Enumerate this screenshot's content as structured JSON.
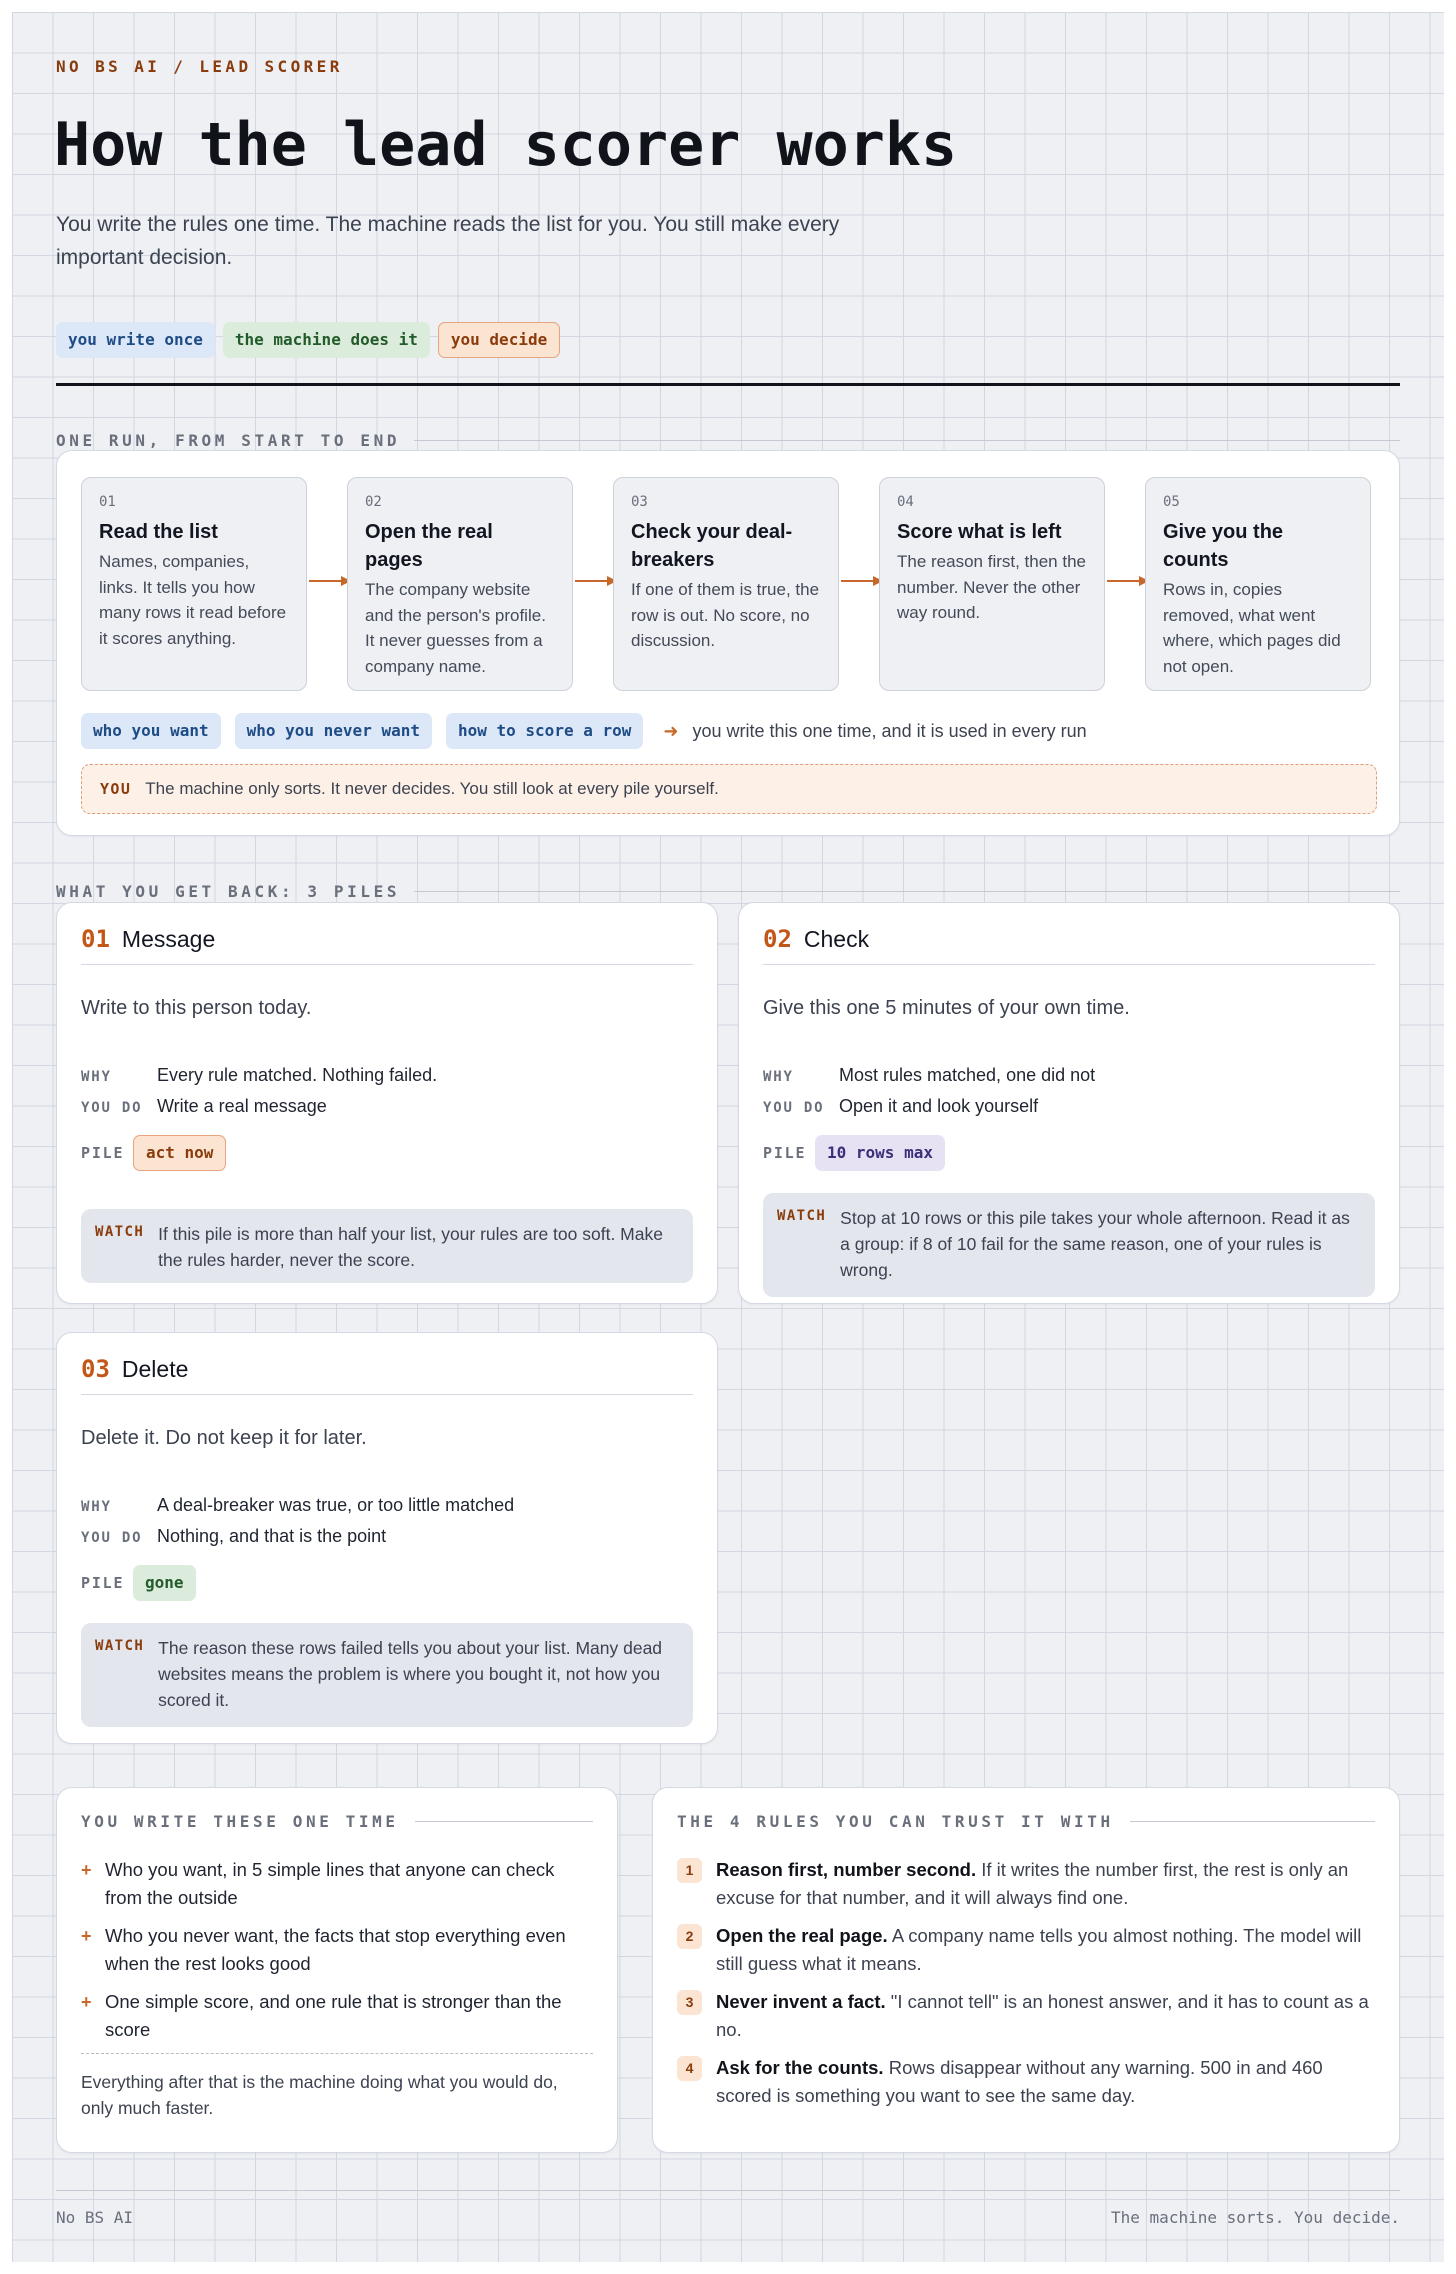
{
  "header": {
    "eyebrow": "NO BS AI / LEAD SCORER",
    "title": "How the lead scorer works",
    "lead": "You write the rules one time. The machine reads the list for you. You still make every important decision."
  },
  "legend": {
    "write_once": "you write once",
    "machine": "the machine does it",
    "decide": "you decide"
  },
  "run": {
    "label": "ONE RUN, FROM START TO END",
    "steps": [
      {
        "num": "01",
        "title": "Read the list",
        "desc": "Names, companies, links. It tells you how many rows it read before it scores anything."
      },
      {
        "num": "02",
        "title": "Open the real pages",
        "desc": "The company website and the person's profile. It never guesses from a company name."
      },
      {
        "num": "03",
        "title": "Check your deal-breakers",
        "desc": "If one of them is true, the row is out. No score, no discussion."
      },
      {
        "num": "04",
        "title": "Score what is left",
        "desc": "The reason first, then the number. Never the other way round."
      },
      {
        "num": "05",
        "title": "Give you the counts",
        "desc": "Rows in, copies removed, what went where, which pages did not open."
      }
    ],
    "inputs": [
      "who you want",
      "who you never want",
      "how to score a row"
    ],
    "inputs_note": "you write this one time, and it is used in every run",
    "you_key": "YOU",
    "you_text": "The machine only sorts. It never decides. You still look at every pile yourself."
  },
  "piles": {
    "label": "WHAT YOU GET BACK: 3 PILES",
    "why_key": "WHY",
    "do_key": "YOU DO",
    "pile_key": "PILE",
    "watch_key": "WATCH",
    "items": [
      {
        "num": "01",
        "title": "Message",
        "intro": "Write to this person today.",
        "why": "Every rule matched. Nothing failed.",
        "do": "Write a real message",
        "pile": "act now",
        "watch": "If this pile is more than half your list, your rules are too soft. Make the rules harder, never the score."
      },
      {
        "num": "02",
        "title": "Check",
        "intro": "Give this one 5 minutes of your own time.",
        "why": "Most rules matched, one did not",
        "do": "Open it and look yourself",
        "pile": "10 rows max",
        "watch": "Stop at 10 rows or this pile takes your whole afternoon. Read it as a group: if 8 of 10 fail for the same reason, one of your rules is wrong."
      },
      {
        "num": "03",
        "title": "Delete",
        "intro": "Delete it. Do not keep it for later.",
        "why": "A deal-breaker was true, or too little matched",
        "do": "Nothing, and that is the point",
        "pile": "gone",
        "watch": "The reason these rows failed tells you about your list. Many dead websites means the problem is where you bought it, not how you scored it."
      }
    ]
  },
  "write_once": {
    "label": "YOU WRITE THESE ONE TIME",
    "marker": "+",
    "items": [
      "Who you want, in 5 simple lines that anyone can check from the outside",
      "Who you never want, the facts that stop everything even when the rest looks good",
      "One simple score, and one rule that is stronger than the score"
    ],
    "note": "Everything after that is the machine doing what you would do, only much faster."
  },
  "trust_rules": {
    "label": "THE 4 RULES YOU CAN TRUST IT WITH",
    "items": [
      {
        "n": "1",
        "bold": "Reason first, number second.",
        "text": "If it writes the number first, the rest is only an excuse for that number, and it will always find one."
      },
      {
        "n": "2",
        "bold": "Open the real page.",
        "text": "A company name tells you almost nothing. The model will still guess what it means."
      },
      {
        "n": "3",
        "bold": "Never invent a fact.",
        "text": "\"I cannot tell\" is an honest answer, and it has to count as a no."
      },
      {
        "n": "4",
        "bold": "Ask for the counts.",
        "text": "Rows disappear without any warning. 500 in and 460 scored is something you want to see the same day."
      }
    ]
  },
  "footer": {
    "left": "No BS AI",
    "right": "The machine sorts. You decide."
  },
  "colors": {
    "accent": "#c7672a",
    "brand_dark": "#8a3c0c",
    "tag_blue": "#dce7f7",
    "tag_green": "#dbecdc",
    "tag_orange": "#fbe4d2",
    "tag_purple": "#e6e2f3"
  }
}
